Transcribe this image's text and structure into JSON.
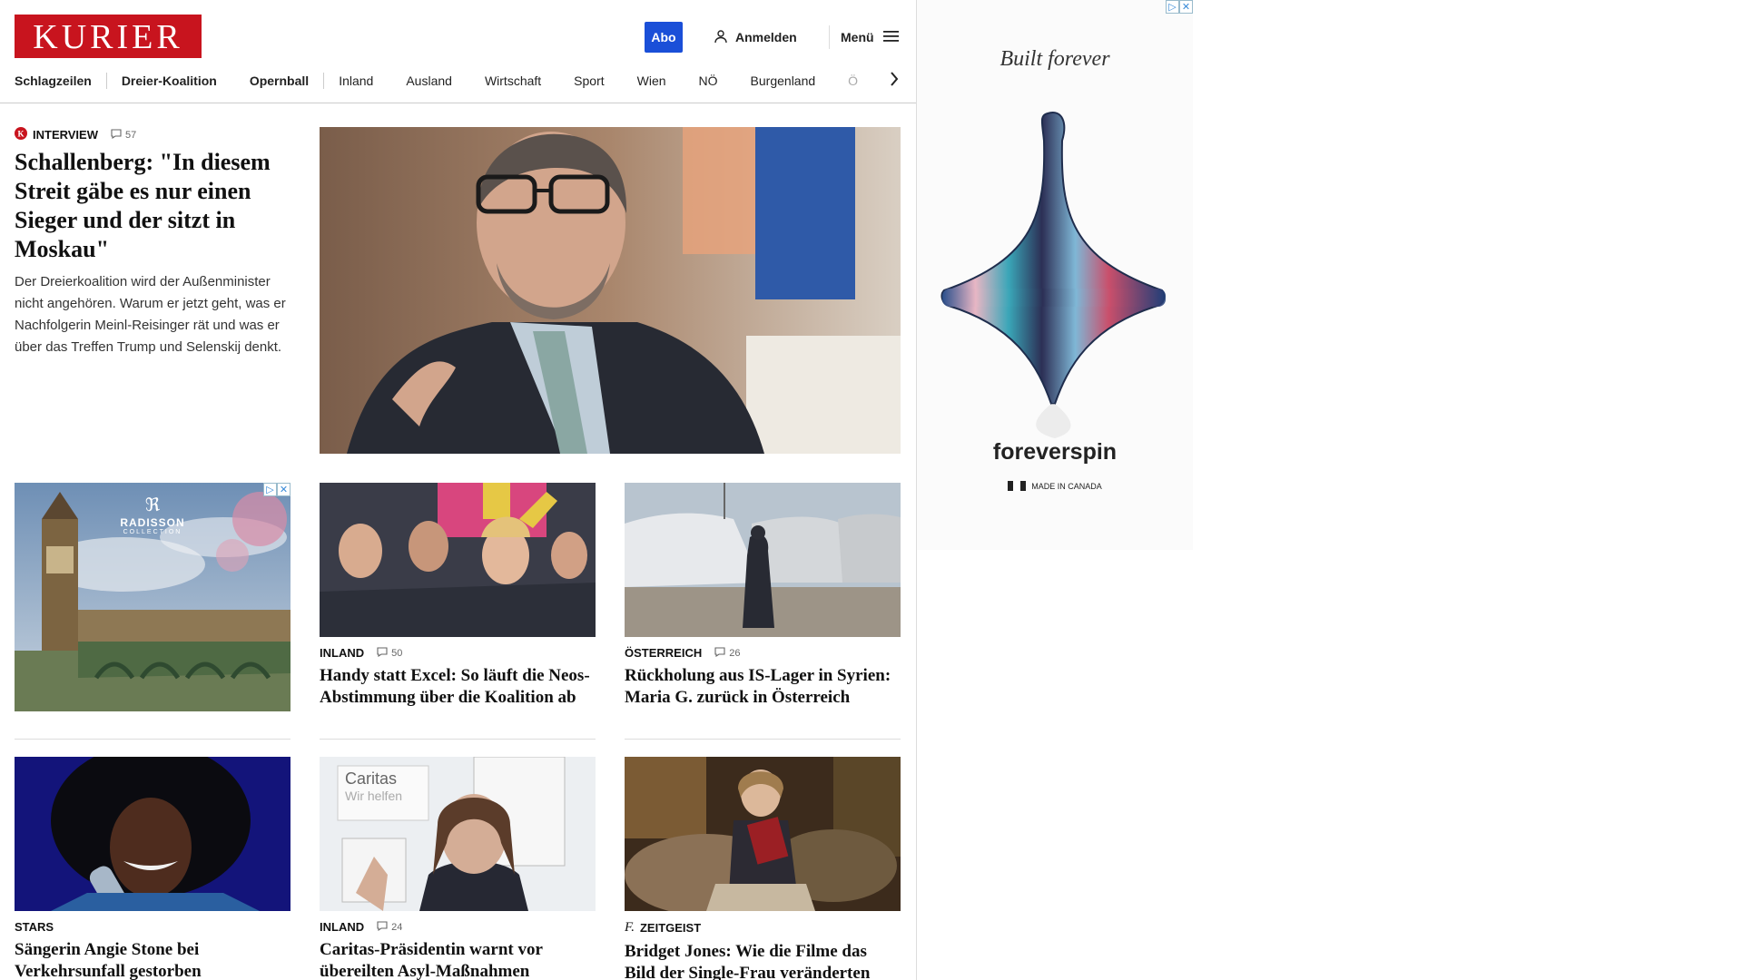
{
  "header": {
    "logo_text": "KURIER",
    "abo_label": "Abo",
    "login_label": "Anmelden",
    "menu_label": "Menü"
  },
  "nav": {
    "items": [
      "Schlagzeilen",
      "Dreier-Koalition",
      "Opernball",
      "Inland",
      "Ausland",
      "Wirtschaft",
      "Sport",
      "Wien",
      "NÖ",
      "Burgenland",
      "Ö"
    ]
  },
  "lead": {
    "category": "INTERVIEW",
    "comments": "57",
    "headline": "Schallenberg: \"In diesem Streit gäbe es nur einen Sieger und der sitzt in Moskau\"",
    "teaser": "Der Dreierkoalition wird der Außenminister nicht angehören. Warum er jetzt geht, was er Nachfolgerin Meinl-Reisinger rät und was er über das Treffen Trump und Selenskij denkt."
  },
  "ad_left": {
    "brand": "RADISSON",
    "sub": "COLLECTION"
  },
  "cards": [
    {
      "category": "INLAND",
      "comments": "50",
      "headline": "Handy statt Excel: So läuft die Neos-Abstimmung über die Koalition ab"
    },
    {
      "category": "ÖSTERREICH",
      "comments": "26",
      "headline": "Rückholung aus IS-Lager in Syrien: Maria G. zurück in Österreich"
    },
    {
      "category": "STARS",
      "comments": "",
      "headline": "Sängerin Angie Stone bei Verkehrsunfall gestorben"
    },
    {
      "category": "INLAND",
      "comments": "24",
      "headline": "Caritas-Präsidentin warnt vor übereilten Asyl-Maßnahmen"
    },
    {
      "category": "ZEITGEIST",
      "comments": "",
      "headline": "Bridget Jones: Wie die Filme das Bild der Single-Frau veränderten"
    }
  ],
  "side_ad": {
    "tagline": "Built forever",
    "brand": "foreverspin",
    "made_in": "MADE IN CANADA"
  },
  "colors": {
    "brand_red": "#c8141e",
    "abo_blue": "#1a4fd8"
  }
}
